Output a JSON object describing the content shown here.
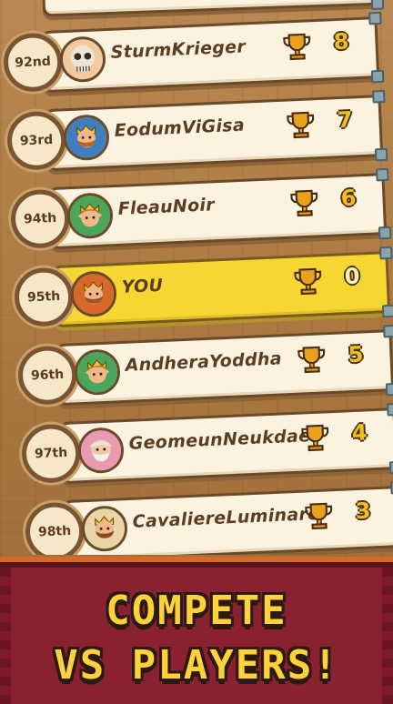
{
  "leaderboard": {
    "rows": [
      {
        "rank": "92nd",
        "name": "SturmKrieger",
        "score": "8",
        "avatar": "skeleton-icon",
        "you": false
      },
      {
        "rank": "93rd",
        "name": "EodumViGisa",
        "score": "7",
        "avatar": "bearded-king-icon",
        "you": false
      },
      {
        "rank": "94th",
        "name": "FleauNoir",
        "score": "6",
        "avatar": "elf-king-icon",
        "you": false
      },
      {
        "rank": "95th",
        "name": "YOU",
        "score": "0",
        "avatar": "bearded-king-icon",
        "you": true
      },
      {
        "rank": "96th",
        "name": "AndheraYoddha",
        "score": "5",
        "avatar": "elf-king-icon",
        "you": false
      },
      {
        "rank": "97th",
        "name": "GeomeunNeukdae",
        "score": "4",
        "avatar": "old-sage-icon",
        "you": false
      },
      {
        "rank": "98th",
        "name": "CavaliereLuminare",
        "score": "3",
        "avatar": "bearded-king-icon",
        "you": false
      }
    ]
  },
  "banner": {
    "line1": "COMPETE",
    "line2": "VS PLAYERS!"
  },
  "colors": {
    "you_highlight": "#f6d632",
    "card": "#fbf2df",
    "banner": "#8a2130",
    "banner_text": "#ffd23c"
  }
}
